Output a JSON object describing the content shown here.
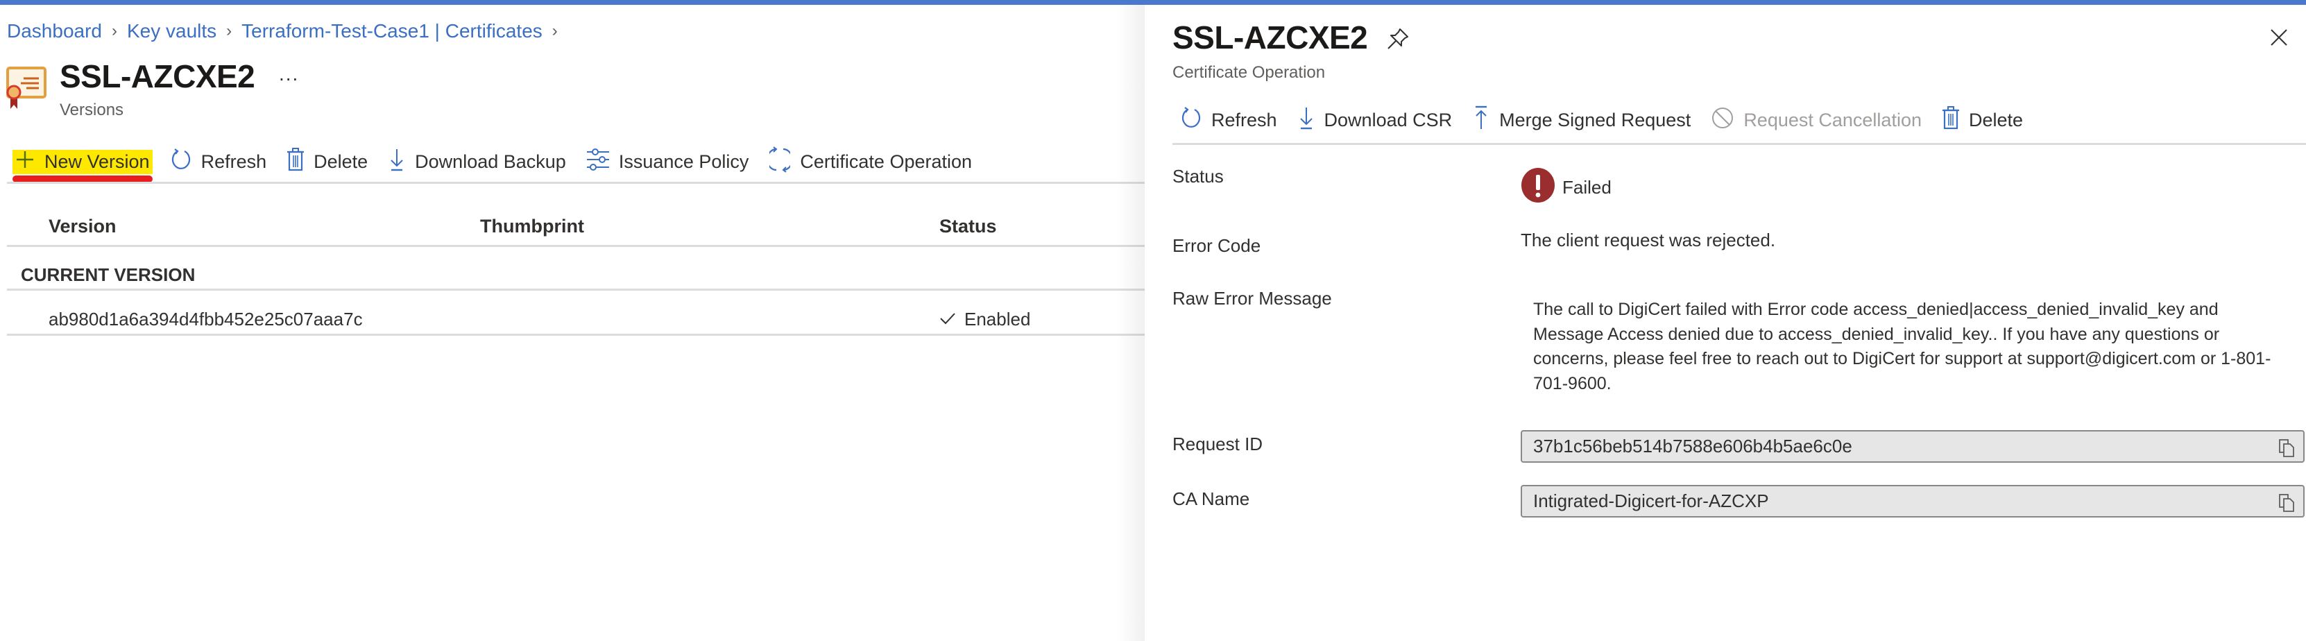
{
  "breadcrumb": [
    {
      "label": "Dashboard"
    },
    {
      "label": "Key vaults"
    },
    {
      "label": "Terraform-Test-Case1 | Certificates"
    }
  ],
  "page": {
    "title": "SSL-AZCXE2",
    "more_label": "...",
    "subtitle": "Versions"
  },
  "left_toolbar": [
    {
      "label": "New Version",
      "icon": "plus-icon",
      "highlighted": true
    },
    {
      "label": "Refresh",
      "icon": "refresh-icon"
    },
    {
      "label": "Delete",
      "icon": "trash-icon"
    },
    {
      "label": "Download Backup",
      "icon": "download-icon"
    },
    {
      "label": "Issuance Policy",
      "icon": "sliders-icon"
    },
    {
      "label": "Certificate Operation",
      "icon": "sync-icon"
    }
  ],
  "table": {
    "columns": [
      "Version",
      "Thumbprint",
      "Status"
    ],
    "group_label": "CURRENT VERSION",
    "rows": [
      {
        "version": "ab980d1a6a394d4fbb452e25c07aaa7c",
        "thumbprint": "",
        "status": "Enabled"
      }
    ]
  },
  "panel": {
    "title": "SSL-AZCXE2",
    "subtitle": "Certificate Operation",
    "toolbar": [
      {
        "label": "Refresh",
        "icon": "refresh-icon",
        "disabled": false
      },
      {
        "label": "Download CSR",
        "icon": "download-icon",
        "disabled": false
      },
      {
        "label": "Merge Signed Request",
        "icon": "upload-icon",
        "disabled": false
      },
      {
        "label": "Request Cancellation",
        "icon": "cancel-icon",
        "disabled": true
      },
      {
        "label": "Delete",
        "icon": "trash-icon",
        "disabled": false
      }
    ],
    "fields": {
      "status_label": "Status",
      "status_value": "Failed",
      "error_code_label": "Error Code",
      "error_code_value": "The client request was rejected.",
      "raw_error_label": "Raw Error Message",
      "raw_error_value": "The call to DigiCert failed with Error code access_denied|access_denied_invalid_key and Message Access denied due to access_denied_invalid_key.. If you have any questions or concerns, please feel free to reach out to DigiCert for support at support@digicert.com or 1-801-701-9600.",
      "request_id_label": "Request ID",
      "request_id_value": "37b1c56beb514b7588e606b4b5ae6c0e",
      "ca_name_label": "CA Name",
      "ca_name_value": "Intigrated-Digicert-for-AZCXP"
    }
  },
  "colors": {
    "accent": "#4a78cc",
    "link": "#3b6fc4",
    "highlight": "#ffe800",
    "underline": "#e81e1e",
    "error": "#9a2e2e"
  }
}
